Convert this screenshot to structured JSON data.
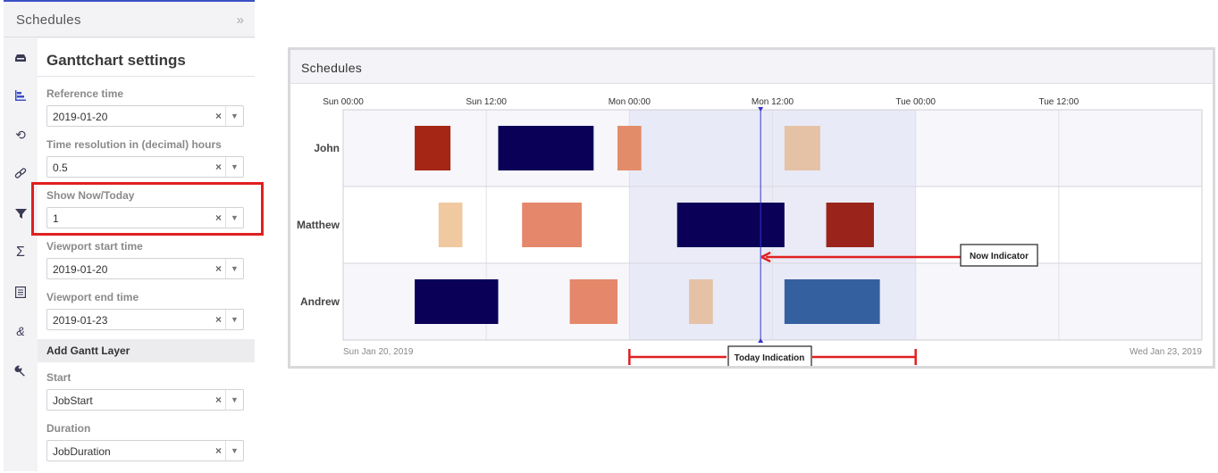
{
  "left_panel": {
    "title": "Schedules",
    "collapse_icon": "double-chevron-right-icon",
    "rail_icons": [
      "tray-icon",
      "gantt-bars-icon",
      "refresh-icon",
      "link-icon",
      "filter-icon",
      "sigma-icon",
      "list-icon",
      "ampersand-icon",
      "wrench-icon"
    ],
    "active_rail_icon": "gantt-bars-icon",
    "settings_title": "Ganttchart settings",
    "fields": [
      {
        "label": "Reference time",
        "value": "2019-01-20"
      },
      {
        "label": "Time resolution in (decimal) hours",
        "value": "0.5"
      },
      {
        "label": "Show Now/Today",
        "value": "1"
      },
      {
        "label": "Viewport start time",
        "value": "2019-01-20"
      },
      {
        "label": "Viewport end time",
        "value": "2019-01-23"
      }
    ],
    "add_layer_label": "Add Gantt Layer",
    "layer_fields": [
      {
        "label": "Start",
        "value": "JobStart"
      },
      {
        "label": "Duration",
        "value": "JobDuration"
      }
    ],
    "clear_symbol": "×",
    "caret_symbol": "▼"
  },
  "chart_panel": {
    "title": "Schedules"
  },
  "chart_data": {
    "type": "gantt",
    "x_ticks": [
      "Sun 00:00",
      "Sun 12:00",
      "Mon 00:00",
      "Mon 12:00",
      "Tue 00:00",
      "Tue 12:00"
    ],
    "x_range_hours": [
      0,
      72
    ],
    "start_date_label": "Sun Jan 20, 2019",
    "end_date_label": "Wed Jan 23, 2019",
    "rows": [
      "John",
      "Matthew",
      "Andrew"
    ],
    "today_window_hours": [
      24,
      48
    ],
    "now_hours": 35,
    "tasks": [
      {
        "row": "John",
        "start": 6,
        "end": 9,
        "color": "#a52614"
      },
      {
        "row": "John",
        "start": 13,
        "end": 21,
        "color": "#0b0057"
      },
      {
        "row": "John",
        "start": 23,
        "end": 25,
        "color": "#e38c6a"
      },
      {
        "row": "John",
        "start": 37,
        "end": 40,
        "color": "#e5c2a6"
      },
      {
        "row": "Matthew",
        "start": 8,
        "end": 10,
        "color": "#f0c9a0"
      },
      {
        "row": "Matthew",
        "start": 15,
        "end": 20,
        "color": "#e5876a"
      },
      {
        "row": "Matthew",
        "start": 28,
        "end": 37,
        "color": "#0b0057"
      },
      {
        "row": "Matthew",
        "start": 40.5,
        "end": 44.5,
        "color": "#9a241b"
      },
      {
        "row": "Andrew",
        "start": 6,
        "end": 13,
        "color": "#0b0057"
      },
      {
        "row": "Andrew",
        "start": 19,
        "end": 23,
        "color": "#e5876a"
      },
      {
        "row": "Andrew",
        "start": 29,
        "end": 31,
        "color": "#e5c2a6"
      },
      {
        "row": "Andrew",
        "start": 37,
        "end": 45,
        "color": "#3560a0"
      }
    ],
    "annotations": {
      "now_label": "Now Indicator",
      "today_label": "Today Indication"
    },
    "colors": {
      "today_fill": "#e6e8f6",
      "now_line": "#3333cc",
      "annotation": "#e02020"
    }
  }
}
